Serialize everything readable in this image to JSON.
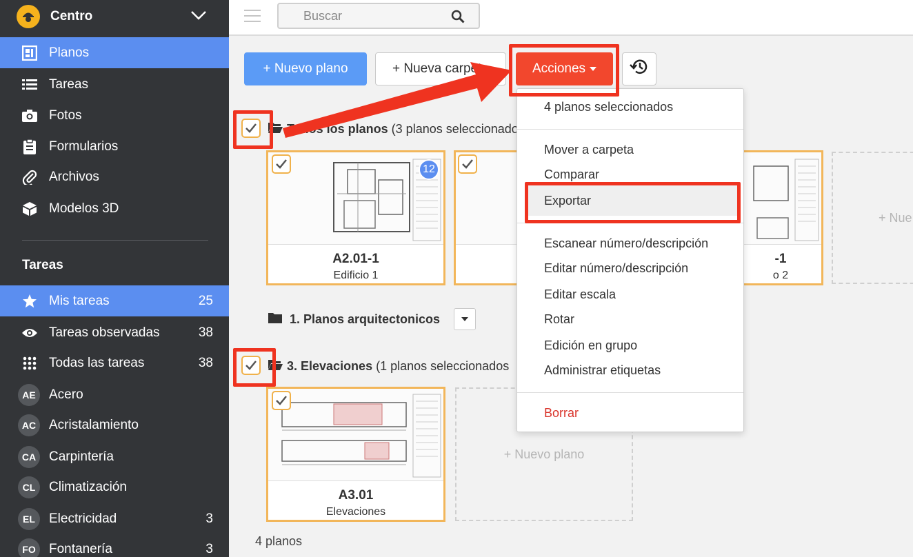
{
  "sidebar": {
    "project": "Centro",
    "nav": [
      {
        "label": "Planos",
        "icon": "plans-icon",
        "active": true
      },
      {
        "label": "Tareas",
        "icon": "list-icon"
      },
      {
        "label": "Fotos",
        "icon": "camera-icon"
      },
      {
        "label": "Formularios",
        "icon": "clipboard-icon"
      },
      {
        "label": "Archivos",
        "icon": "paperclip-icon"
      },
      {
        "label": "Modelos 3D",
        "icon": "cube-icon"
      }
    ],
    "tasks_section": "Tareas",
    "tasks": [
      {
        "label": "Mis tareas",
        "count": "25",
        "icon": "star-icon",
        "active": true
      },
      {
        "label": "Tareas observadas",
        "count": "38",
        "icon": "eye-icon"
      },
      {
        "label": "Todas las tareas",
        "count": "38",
        "icon": "grid-icon"
      },
      {
        "label": "Acero",
        "count": "",
        "abbr": "AE"
      },
      {
        "label": "Acristalamiento",
        "count": "",
        "abbr": "AC"
      },
      {
        "label": "Carpintería",
        "count": "",
        "abbr": "CA"
      },
      {
        "label": "Climatización",
        "count": "",
        "abbr": "CL"
      },
      {
        "label": "Electricidad",
        "count": "3",
        "abbr": "EL"
      },
      {
        "label": "Fontanería",
        "count": "3",
        "abbr": "FO"
      }
    ]
  },
  "topbar": {
    "search_placeholder": "Buscar"
  },
  "toolbar": {
    "new_plan": "+ Nuevo plano",
    "new_folder": "+ Nueva carpeta",
    "actions": "Acciones"
  },
  "folders": {
    "all": {
      "name": "Todos los planos",
      "note": "(3 planos seleccionados"
    },
    "arch": {
      "name": "1. Planos arquitectonicos"
    },
    "elev": {
      "name": "3. Elevaciones",
      "note": "(1 planos seleccionados"
    }
  },
  "cards": {
    "c1": {
      "name": "A2.01-1",
      "sub": "Edificio 1",
      "badge": "12"
    },
    "c3": {
      "name": "-1",
      "sub": "o 2"
    },
    "c4": {
      "name": "A3.01",
      "sub": "Elevaciones"
    }
  },
  "placeholders": {
    "top": "+ Nue",
    "bottom": "+ Nuevo plano"
  },
  "footer": {
    "count": "4 planos"
  },
  "menu": {
    "header": "4 planos seleccionados",
    "group1": [
      "Mover a carpeta",
      "Comparar",
      "Exportar"
    ],
    "group2": [
      "Escanear número/descripción",
      "Editar número/descripción",
      "Editar escala",
      "Rotar",
      "Edición en grupo",
      "Administrar etiquetas"
    ],
    "delete": "Borrar"
  },
  "colors": {
    "sidebar_bg": "#333538",
    "accent_blue": "#5b8ef0",
    "annotation_red": "#ef3320",
    "checkbox_orange": "#f0b14a"
  }
}
